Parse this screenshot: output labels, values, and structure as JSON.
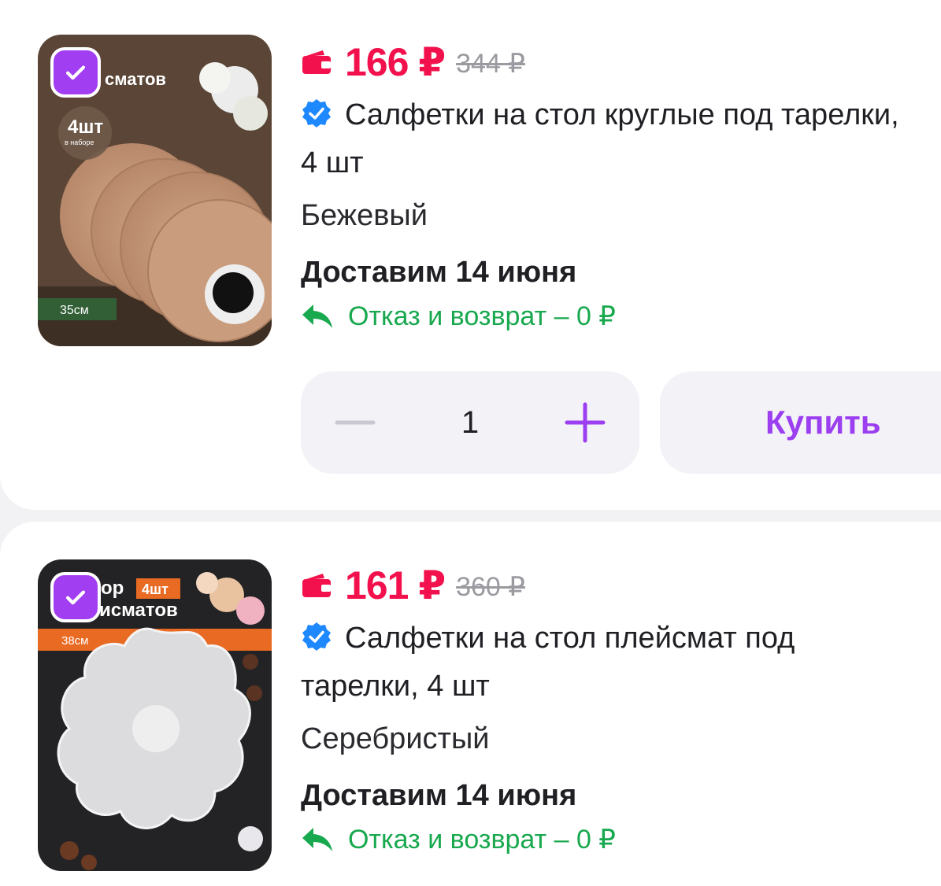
{
  "colors": {
    "accent": "#a23ef2",
    "price": "#f2114c",
    "returns": "#18a84e",
    "verified": "#1e88ff"
  },
  "items": [
    {
      "image_icon": "placemat-round-beige-image",
      "image_text": {
        "brand": "р\nсматов",
        "count": "4шт",
        "count_sub": "в наборе",
        "size": "35см"
      },
      "selected": true,
      "price": "166 ₽",
      "old_price": "344 ₽",
      "title": "Салфетки на стол круглые под тарелки, 4 шт",
      "variant": "Бежевый",
      "delivery": "Доставим 14 июня",
      "returns": "Отказ и возврат – 0 ₽",
      "quantity": "1",
      "buy_label": "Купить"
    },
    {
      "image_icon": "placemat-flower-silver-image",
      "image_text": {
        "brand": "ор\nисматов",
        "count": "4шт",
        "size": "38см"
      },
      "selected": true,
      "price": "161 ₽",
      "old_price": "360 ₽",
      "title": "Салфетки на стол плейсмат под тарелки, 4 шт",
      "variant": "Серебристый",
      "delivery": "Доставим 14 июня",
      "returns": "Отказ и возврат – 0 ₽"
    }
  ]
}
